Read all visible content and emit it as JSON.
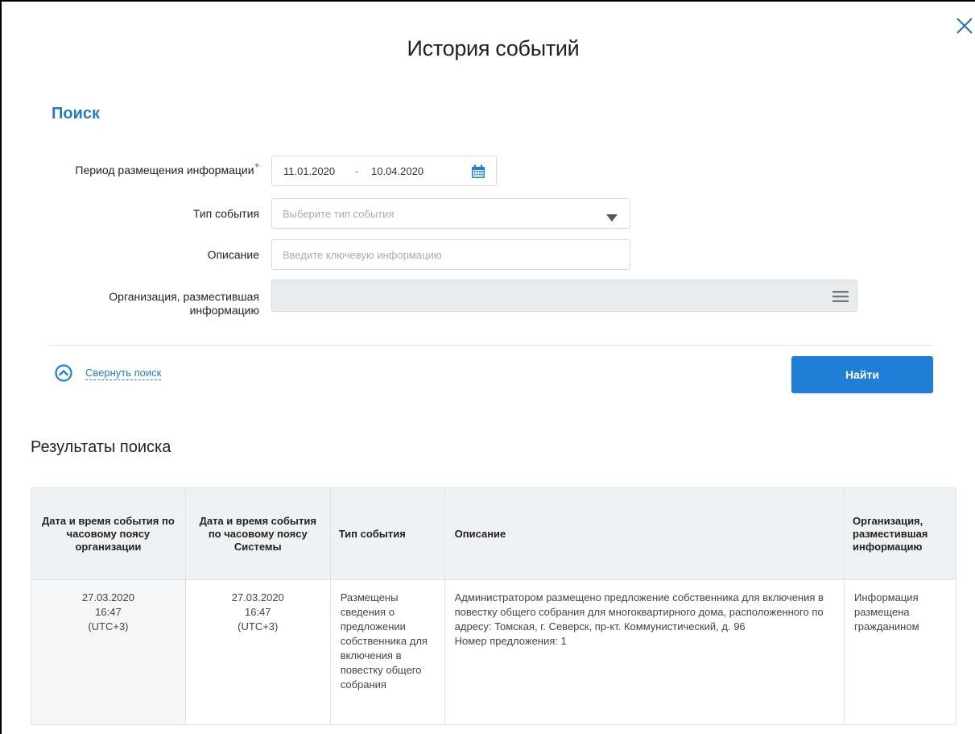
{
  "modal": {
    "title": "История событий",
    "close_icon": "close-icon"
  },
  "search": {
    "heading": "Поиск",
    "period": {
      "label": "Период размещения информации",
      "required_mark": "*",
      "from": "11.01.2020",
      "separator": "-",
      "to": "10.04.2020",
      "icon": "calendar-icon"
    },
    "event_type": {
      "label": "Тип события",
      "placeholder": "Выберите тип события",
      "icon": "caret-down-icon"
    },
    "description": {
      "label": "Описание",
      "placeholder": "Введите ключевую информацию"
    },
    "organization": {
      "label_line1": "Организация, разместившая",
      "label_line2": "информацию",
      "icon": "menu-icon"
    },
    "collapse_label": "Свернуть поиск",
    "find_label": "Найти"
  },
  "results": {
    "heading": "Результаты поиска",
    "columns": [
      "Дата и время события по часовому поясу организации",
      "Дата и время события по часовому поясу Системы",
      "Тип события",
      "Описание",
      "Организация, разместившая информацию"
    ],
    "rows": [
      {
        "org_date": "27.03.2020",
        "org_time": "16:47",
        "org_tz": "(UTC+3)",
        "sys_date": "27.03.2020",
        "sys_time": "16:47",
        "sys_tz": "(UTC+3)",
        "event_type": "Размещены сведения о предложении собственника для включения в повестку общего собрания",
        "description": "Администратором размещено предложение собственника для включения в повестку общего собрания для многоквартирного дома, расположенного по адресу: Томская, г. Северск, пр-кт. Коммунистический, д. 96",
        "proposal_number": "Номер предложения: 1",
        "organization": "Информация размещена гражданином"
      }
    ]
  },
  "colors": {
    "accent": "#1f7fd6",
    "heading_blue": "#2a7bbd",
    "required": "#d23a3a",
    "header_bg": "#eef2f4"
  }
}
